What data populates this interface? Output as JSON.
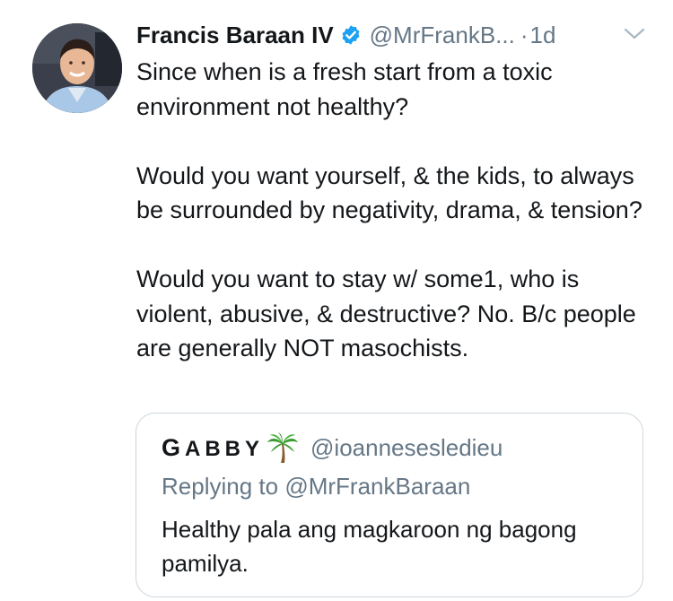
{
  "tweet": {
    "author": {
      "display_name": "Francis Baraan IV",
      "handle": "@MrFrankB...",
      "verified": true,
      "verified_color": "#1da1f2",
      "avatar_icon": "profile-photo"
    },
    "separator": "·",
    "time": "1d",
    "menu_icon": "chevron-down-icon",
    "paragraphs": [
      "Since when is a fresh start from a toxic environment not healthy?",
      "Would you want yourself, & the kids, to always be surrounded by negativity, drama, & tension?",
      "Would you want to stay w/ some1, who is violent, abusive, & destructive? No. B/c people are generally NOT masochists."
    ]
  },
  "quote": {
    "display_name_first": "G",
    "display_name_rest": "ABBY",
    "emoji_icon": "palm-tree-icon",
    "handle": "@ioannesesledieu",
    "replying_prefix": "Replying to ",
    "replying_to": "@MrFrankBaraan",
    "text": "Healthy pala ang magkaroon ng bagong pamilya."
  },
  "colors": {
    "text_primary": "#14171a",
    "text_secondary": "#657786",
    "border": "#ccd6dd",
    "verified_blue": "#1da1f2"
  }
}
